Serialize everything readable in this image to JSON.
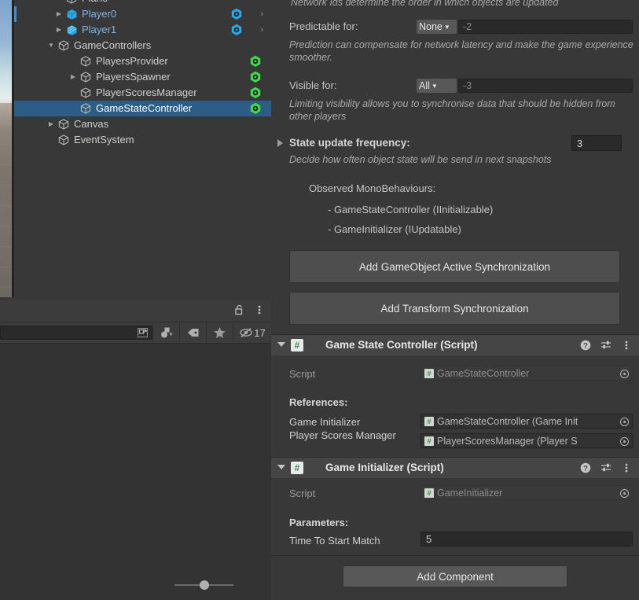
{
  "hierarchy": {
    "rows": [
      {
        "label": "Plane",
        "indent": 72,
        "arrow": "none",
        "style": "normal",
        "netid": "none",
        "chevron": false,
        "selected": false,
        "clippedTop": true
      },
      {
        "label": "Player0",
        "indent": 72,
        "arrow": "closed",
        "style": "prefab",
        "netid": "blue",
        "chevron": true,
        "selected": false,
        "selectionMark": true
      },
      {
        "label": "Player1",
        "indent": 72,
        "arrow": "closed",
        "style": "prefab",
        "netid": "blue",
        "chevron": true,
        "selected": false
      },
      {
        "label": "GameControllers",
        "indent": 62,
        "arrow": "open",
        "style": "normal",
        "netid": "none",
        "chevron": false,
        "selected": false
      },
      {
        "label": "PlayersProvider",
        "indent": 90,
        "arrow": "none",
        "style": "normal",
        "netid": "green",
        "chevron": false,
        "selected": false
      },
      {
        "label": "PlayersSpawner",
        "indent": 90,
        "arrow": "closed",
        "style": "normal",
        "netid": "green",
        "chevron": false,
        "selected": false
      },
      {
        "label": "PlayerScoresManager",
        "indent": 90,
        "arrow": "none",
        "style": "normal",
        "netid": "green",
        "chevron": false,
        "selected": false
      },
      {
        "label": "GameStateController",
        "indent": 90,
        "arrow": "none",
        "style": "normal",
        "netid": "green",
        "chevron": false,
        "selected": true
      },
      {
        "label": "Canvas",
        "indent": 62,
        "arrow": "closed",
        "style": "normal",
        "netid": "none",
        "chevron": false,
        "selected": false
      },
      {
        "label": "EventSystem",
        "indent": 62,
        "arrow": "none",
        "style": "normal",
        "netid": "none",
        "chevron": false,
        "selected": false
      }
    ]
  },
  "lower_panel": {
    "search_placeholder": "",
    "search_value": "",
    "hidden_count": "17",
    "icons": {
      "lock": "lock-open-icon",
      "menu": "kebab-menu-icon",
      "search_select": "search-select-icon",
      "filter_type": "filter-by-type-icon",
      "filter_label": "filter-by-label-icon",
      "favorites": "star-icon",
      "hidden_objects": "eye-off-icon"
    }
  },
  "inspector": {
    "clipped_description": "Network Ids determine the order in which objects are updated",
    "predictable": {
      "label": "Predictable for:",
      "dropdown_value": "None",
      "field_value": "-2",
      "help": "Prediction can compensate for network latency and make the game experience smoother."
    },
    "visible": {
      "label": "Visible for:",
      "dropdown_value": "All",
      "field_value": "-3",
      "help": "Limiting visibility allows you to synchronise data that should be hidden from other players"
    },
    "state_update": {
      "label": "State update frequency:",
      "value": "3",
      "help": "Decide how often object state will be send in next snapshots"
    },
    "observed": {
      "title": "Observed MonoBehaviours:",
      "items": [
        "- GameStateController (IInitializable)",
        "- GameInitializer (IUpdatable)"
      ]
    },
    "buttons": {
      "add_gameobject_active_sync": "Add GameObject Active Synchronization",
      "add_transform_sync": "Add Transform Synchronization",
      "add_component": "Add Component"
    },
    "components": [
      {
        "title": "Game State Controller (Script)",
        "script_glyph": "#",
        "script_label": "Script",
        "script_value": "GameStateController",
        "section_label": "References:",
        "fields": [
          {
            "label": "Game Initializer",
            "value": "GameStateController (Game Init",
            "type": "object"
          },
          {
            "label": "Player Scores Manager",
            "value": "PlayerScoresManager (Player S",
            "type": "object"
          }
        ]
      },
      {
        "title": "Game Initializer (Script)",
        "script_glyph": "#",
        "script_label": "Script",
        "script_value": "GameInitializer",
        "section_label": "Parameters:",
        "fields": [
          {
            "label": "Time To Start Match",
            "value": "5",
            "type": "number"
          }
        ]
      }
    ],
    "header_icons": {
      "help": "help-icon",
      "preset": "preset-icon",
      "menu": "kebab-menu-icon"
    }
  },
  "colors": {
    "selection_blue": "#2c5d87",
    "prefab_blue": "#7eb3e8",
    "netid_green": "#3fdb4a",
    "netid_blue": "#2ba8e8",
    "panel_bg": "#383838"
  }
}
